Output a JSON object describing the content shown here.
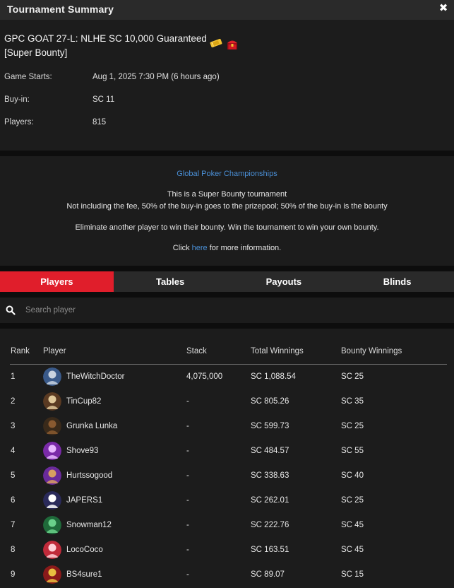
{
  "window": {
    "title": "Tournament Summary",
    "close_icon": "close-icon"
  },
  "tournament": {
    "name": "GPC GOAT 27-L: NLHE SC 10,000 Guaranteed [Super Bounty]",
    "badges": [
      "ticket-icon",
      "treasure-chest-icon"
    ],
    "game_starts_label": "Game Starts:",
    "game_starts_value": "Aug 1, 2025 7:30 PM (6 hours ago)",
    "buyin_label": "Buy-in:",
    "buyin_value": "SC 11",
    "players_label": "Players:",
    "players_value": "815"
  },
  "description": {
    "series_link": "Global Poker Championships",
    "line1": "This is a Super Bounty tournament",
    "line2": "Not including the fee, 50% of the buy-in goes to the prizepool; 50% of the buy-in is the bounty",
    "line3": "Eliminate another player to win their bounty. Win the tournament to win your own bounty.",
    "click_prefix": "Click",
    "click_link": "here",
    "click_suffix": "for more information."
  },
  "tabs": [
    {
      "label": "Players",
      "active": true
    },
    {
      "label": "Tables",
      "active": false
    },
    {
      "label": "Payouts",
      "active": false
    },
    {
      "label": "Blinds",
      "active": false
    }
  ],
  "search": {
    "icon": "search-icon",
    "placeholder": "Search player",
    "value": ""
  },
  "table": {
    "headers": {
      "rank": "Rank",
      "player": "Player",
      "stack": "Stack",
      "total": "Total Winnings",
      "bounty": "Bounty Winnings"
    },
    "rows": [
      {
        "rank": "1",
        "player": "TheWitchDoctor",
        "stack": "4,075,000",
        "total": "SC 1,088.54",
        "bounty": "SC 25",
        "avatar_colors": [
          "#3a5a8a",
          "#c9d3e0"
        ]
      },
      {
        "rank": "2",
        "player": "TinCup82",
        "stack": "-",
        "total": "SC 805.26",
        "bounty": "SC 35",
        "avatar_colors": [
          "#5a3a22",
          "#e0c89a"
        ]
      },
      {
        "rank": "3",
        "player": "Grunka Lunka",
        "stack": "-",
        "total": "SC 599.73",
        "bounty": "SC 25",
        "avatar_colors": [
          "#3a2a1a",
          "#8a5a30"
        ]
      },
      {
        "rank": "4",
        "player": "Shove93",
        "stack": "-",
        "total": "SC 484.57",
        "bounty": "SC 55",
        "avatar_colors": [
          "#7a2aa8",
          "#e8b8ff"
        ]
      },
      {
        "rank": "5",
        "player": "Hurtssogood",
        "stack": "-",
        "total": "SC 338.63",
        "bounty": "SC 40",
        "avatar_colors": [
          "#6a2a9a",
          "#d8a060"
        ]
      },
      {
        "rank": "6",
        "player": "JAPERS1",
        "stack": "-",
        "total": "SC 262.01",
        "bounty": "SC 25",
        "avatar_colors": [
          "#2a2a5a",
          "#ffffff"
        ]
      },
      {
        "rank": "7",
        "player": "Snowman12",
        "stack": "-",
        "total": "SC 222.76",
        "bounty": "SC 45",
        "avatar_colors": [
          "#1f6a3a",
          "#6ad08a"
        ]
      },
      {
        "rank": "8",
        "player": "LocoCoco",
        "stack": "-",
        "total": "SC 163.51",
        "bounty": "SC 45",
        "avatar_colors": [
          "#c02a3a",
          "#ffd0d8"
        ]
      },
      {
        "rank": "9",
        "player": "BS4sure1",
        "stack": "-",
        "total": "SC 89.07",
        "bounty": "SC 15",
        "avatar_colors": [
          "#8a1a1a",
          "#e8c040"
        ]
      }
    ]
  },
  "colors": {
    "accent_red": "#e01e2b",
    "link_blue": "#4a8fd6",
    "panel": "#1c1c1c",
    "header": "#2a2a2a"
  }
}
